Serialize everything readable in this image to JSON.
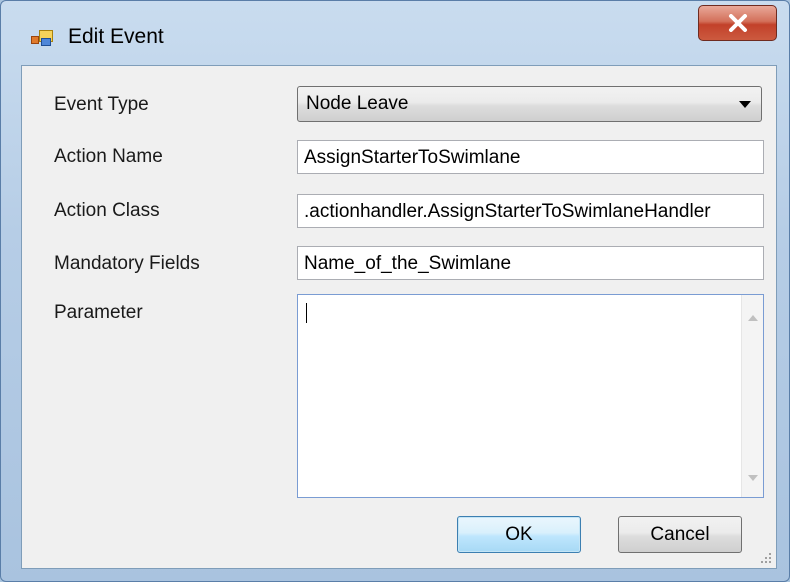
{
  "window": {
    "title": "Edit Event",
    "icon": "app-form-icon",
    "close_icon": "close-icon"
  },
  "form": {
    "event_type": {
      "label": "Event Type",
      "value": "Node Leave"
    },
    "action_name": {
      "label": "Action Name",
      "value": "AssignStarterToSwimlane"
    },
    "action_class": {
      "label": "Action Class",
      "value": ".actionhandler.AssignStarterToSwimlaneHandler"
    },
    "mandatory_fields": {
      "label": "Mandatory Fields",
      "value": "Name_of_the_Swimlane"
    },
    "parameter": {
      "label": "Parameter",
      "value": ""
    }
  },
  "buttons": {
    "ok": "OK",
    "cancel": "Cancel"
  },
  "colors": {
    "close_button": "#c2412a",
    "ok_button_border": "#3c7fb1",
    "client_bg": "#f0f0f0"
  }
}
